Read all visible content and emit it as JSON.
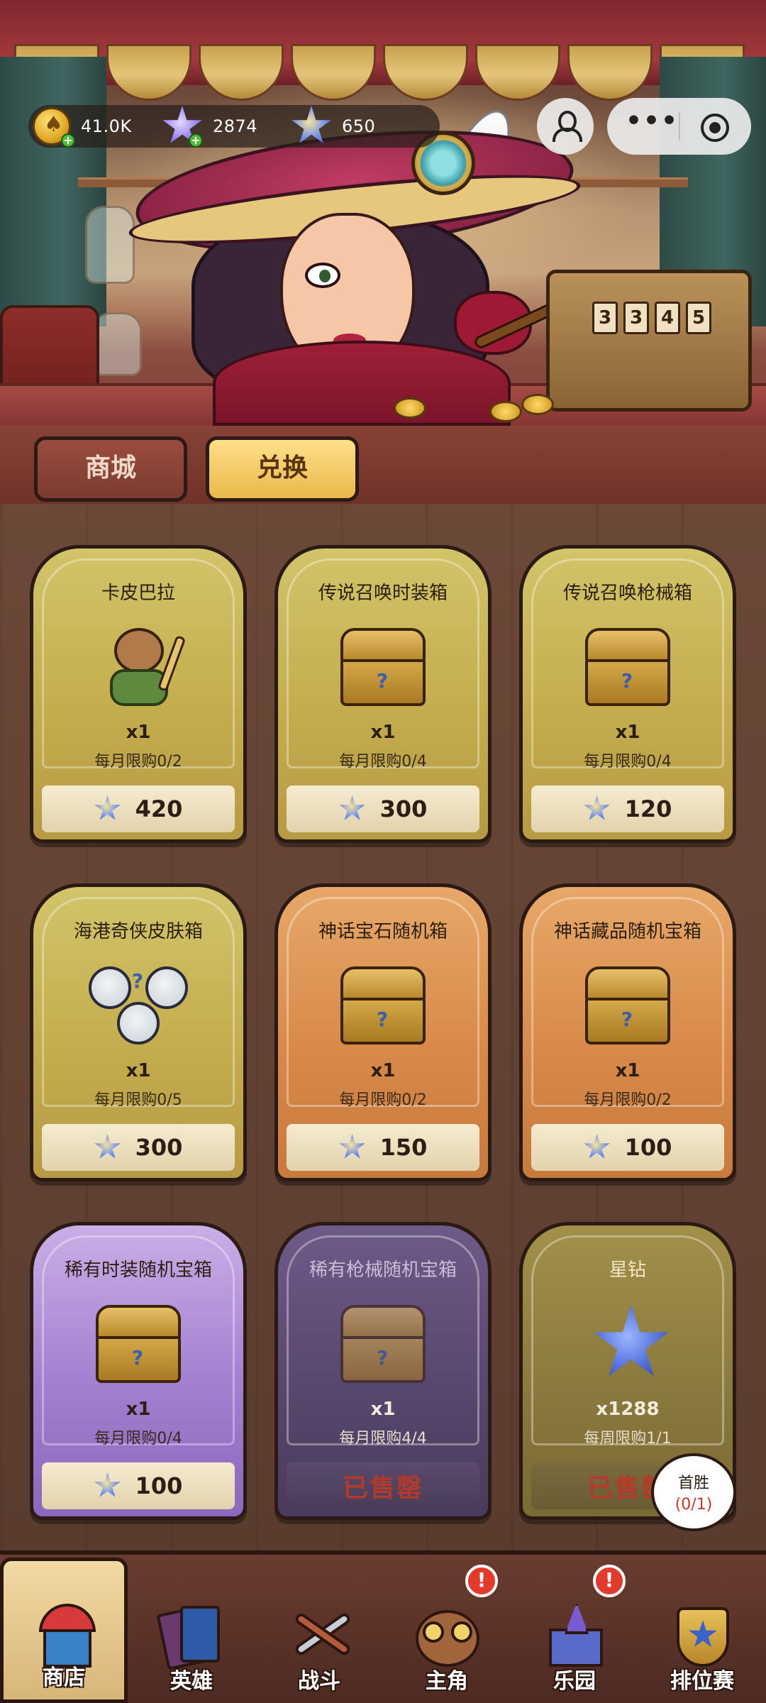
{
  "resources": {
    "gold": "41.0K",
    "purple_star": "2874",
    "blue_star": "650"
  },
  "tabs": [
    {
      "label": "商城",
      "active": false
    },
    {
      "label": "兑换",
      "active": true
    }
  ],
  "items": [
    {
      "title": "卡皮巴拉",
      "qty": "x1",
      "limit": "每月限购0/2",
      "price": "420",
      "theme": "gold",
      "art": "capybara"
    },
    {
      "title": "传说召唤时装箱",
      "qty": "x1",
      "limit": "每月限购0/4",
      "price": "300",
      "theme": "gold",
      "art": "chest"
    },
    {
      "title": "传说召唤枪械箱",
      "qty": "x1",
      "limit": "每月限购0/4",
      "price": "120",
      "theme": "gold",
      "art": "chest"
    },
    {
      "title": "海港奇侠皮肤箱",
      "qty": "x1",
      "limit": "每月限购0/5",
      "price": "300",
      "theme": "gold",
      "art": "bubbles"
    },
    {
      "title": "神话宝石随机箱",
      "qty": "x1",
      "limit": "每月限购0/2",
      "price": "150",
      "theme": "orange",
      "art": "chest"
    },
    {
      "title": "神话藏品随机宝箱",
      "qty": "x1",
      "limit": "每月限购0/2",
      "price": "100",
      "theme": "orange",
      "art": "chest"
    },
    {
      "title": "稀有时装随机宝箱",
      "qty": "x1",
      "limit": "每月限购0/4",
      "price": "100",
      "theme": "purple",
      "art": "chest"
    },
    {
      "title": "稀有枪械随机宝箱",
      "qty": "x1",
      "limit": "每月限购4/4",
      "price": "已售罄",
      "sold_out": true,
      "theme": "dark",
      "art": "chest"
    },
    {
      "title": "星钻",
      "qty": "x1288",
      "limit": "每周限购1/1",
      "price": "已售罄",
      "sold_out": true,
      "theme": "olive",
      "art": "star"
    }
  ],
  "first_win": {
    "label": "首胜",
    "progress": "(0/1)"
  },
  "nav": [
    {
      "label": "商店",
      "active": true,
      "alert": false,
      "icon": "shop-icon"
    },
    {
      "label": "英雄",
      "active": false,
      "alert": false,
      "icon": "hero-cards-icon"
    },
    {
      "label": "战斗",
      "active": false,
      "alert": false,
      "icon": "battle-swords-icon"
    },
    {
      "label": "主角",
      "active": false,
      "alert": true,
      "icon": "owl-icon"
    },
    {
      "label": "乐园",
      "active": false,
      "alert": true,
      "icon": "castle-icon"
    },
    {
      "label": "排位赛",
      "active": false,
      "alert": false,
      "icon": "rank-shield-icon"
    }
  ],
  "colors": {
    "gold_card": "#c4ad4e",
    "orange_card": "#d98a4a",
    "purple_card": "#a37fd0",
    "sold_out_text": "#b03a2c",
    "alert_badge": "#e23a2c"
  }
}
